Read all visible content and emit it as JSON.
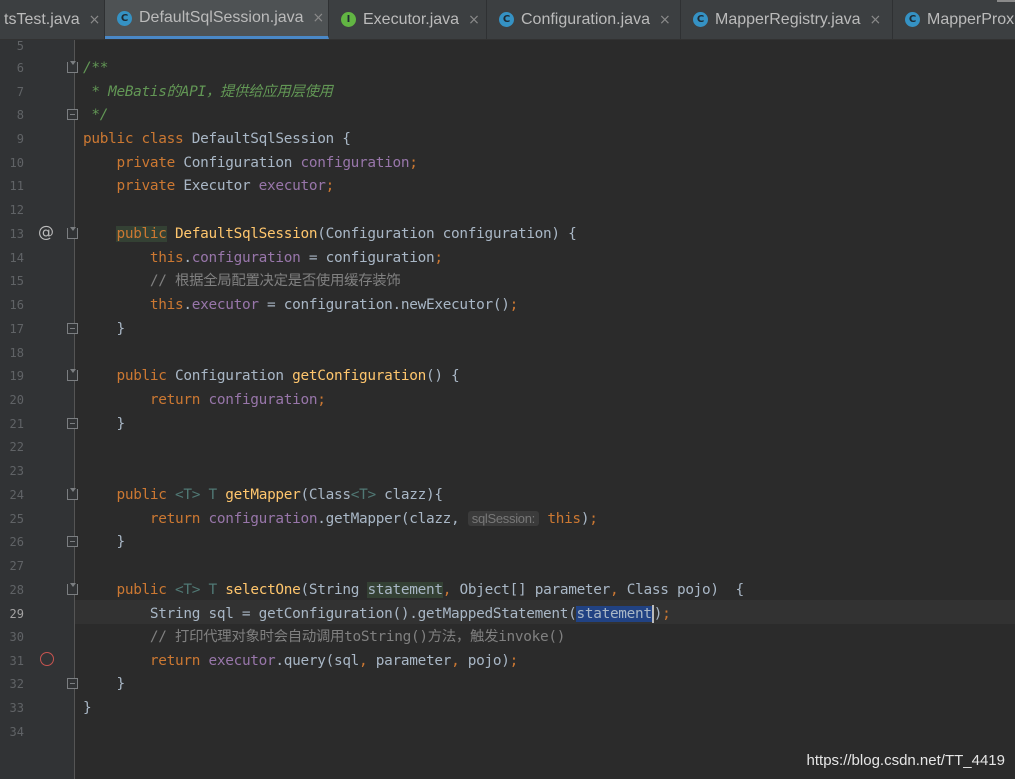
{
  "tabs": [
    {
      "label": "tsTest.java",
      "type": "class"
    },
    {
      "label": "DefaultSqlSession.java",
      "type": "class",
      "active": true
    },
    {
      "label": "Executor.java",
      "type": "interface"
    },
    {
      "label": "Configuration.java",
      "type": "class"
    },
    {
      "label": "MapperRegistry.java",
      "type": "class"
    },
    {
      "label": "MapperProx",
      "type": "class"
    }
  ],
  "tab_icons": {
    "class": "C",
    "interface": "I"
  },
  "close_glyph": "×",
  "line_numbers": [
    "5",
    "6",
    "7",
    "8",
    "9",
    "10",
    "11",
    "12",
    "13",
    "14",
    "15",
    "16",
    "17",
    "18",
    "19",
    "20",
    "21",
    "22",
    "23",
    "24",
    "25",
    "26",
    "27",
    "28",
    "29",
    "30",
    "31",
    "32",
    "33",
    "34"
  ],
  "current_line": "29",
  "code": {
    "l6": "/**",
    "l7": " * MeBatis的API，提供给应用层使用",
    "l8": " */",
    "l9_kw": "public class",
    "l9_rest": " DefaultSqlSession {",
    "l10_kw": "private",
    "l10_type": " Configuration ",
    "l10_field": "configuration",
    "l11_kw": "private",
    "l11_type": " Executor ",
    "l11_field": "executor",
    "l13_kw": "public",
    "l13_fn": "DefaultSqlSession",
    "l13_rest": "(Configuration configuration) {",
    "l14_this": "this",
    "l14_field": "configuration",
    "l14_rest": " = configuration",
    "l15": "// 根据全局配置决定是否使用缓存装饰",
    "l16_this": "this",
    "l16_field": "executor",
    "l16_rest": " = configuration.newExecutor()",
    "l17": "}",
    "l19_kw": "public",
    "l19_type": " Configuration ",
    "l19_fn": "getConfiguration",
    "l19_rest": "() {",
    "l20_kw": "return",
    "l20_field": "configuration",
    "l21": "}",
    "l24_kw": "public",
    "l24_tp": "<T>",
    "l24_tp2": "T",
    "l24_fn": "getMapper",
    "l24_rest1": "(Class",
    "l24_rest2": " clazz){",
    "l25_kw": "return",
    "l25_field": "configuration",
    "l25_rest": ".getMapper(clazz, ",
    "l25_hint": "sqlSession:",
    "l25_this": "this",
    "l26": "}",
    "l28_kw": "public",
    "l28_fn": "selectOne",
    "l28_rest1": "(String ",
    "l28_param": "statement",
    "l28_rest2": " Object[] parameter",
    "l28_rest3": " Class pojo)  {",
    "l29_rest1": "String sql = getConfiguration().getMappedStatement(",
    "l29_sel": "statement",
    "l30": "// 打印代理对象时会自动调用toString()方法，触发invoke()",
    "l31_kw": "return",
    "l31_field": "executor",
    "l31_rest": ".query(sql",
    "l31_rest2": " parameter",
    "l31_rest3": " pojo)",
    "l32": "}",
    "l33": "}"
  },
  "punct": {
    "semi": ";",
    "comma": ",",
    "dot": ".",
    "paren_close": ")"
  },
  "watermark": "https://blog.csdn.net/TT_4419"
}
